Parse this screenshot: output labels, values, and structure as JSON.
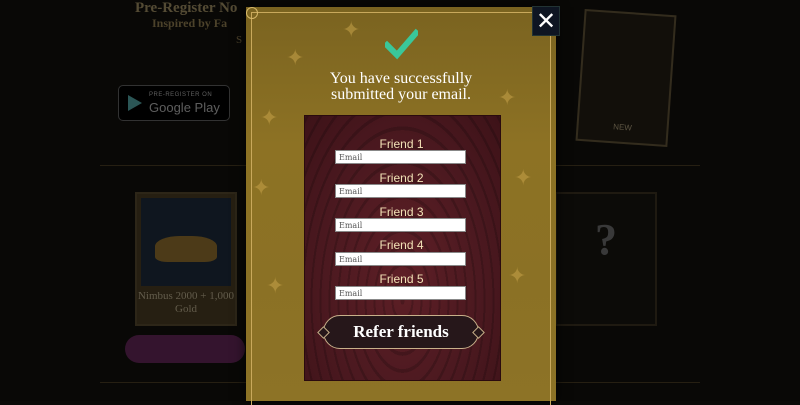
{
  "background": {
    "title": "Pre-Register No",
    "subtitle": "Inspired by Fa",
    "subtitle2": "S",
    "play_small": "PRE-REGISTER ON",
    "play_big": "Google Play",
    "card_caption": "Nimbus 2000 + 1,000 Gold",
    "mystery_card": "?",
    "tilted_card_label": "NEW"
  },
  "modal": {
    "close_icon": "close-icon",
    "check_icon": "checkmark-icon",
    "success_message": "You have successfully submitted your email.",
    "friends": [
      {
        "label": "Friend 1",
        "placeholder": "Email"
      },
      {
        "label": "Friend 2",
        "placeholder": "Email"
      },
      {
        "label": "Friend 3",
        "placeholder": "Email"
      },
      {
        "label": "Friend 4",
        "placeholder": "Email"
      },
      {
        "label": "Friend 5",
        "placeholder": "Email"
      }
    ],
    "refer_button": "Refer friends"
  },
  "colors": {
    "modal_gold": "#8d7224",
    "panel_maroon": "#4c1920",
    "check_green": "#3ac79a",
    "button_dark": "#26171a"
  }
}
